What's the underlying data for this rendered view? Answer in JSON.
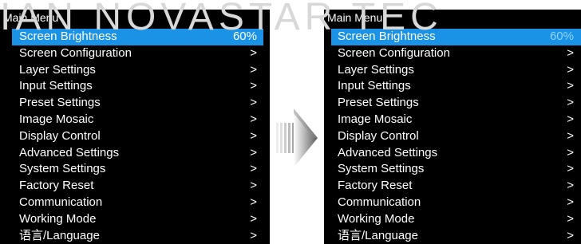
{
  "watermark": "IAN NOVASTAR TEC",
  "left_panel": {
    "title": "Main Menu",
    "items": [
      {
        "label": "Screen Brightness",
        "value": "60%"
      },
      {
        "label": "Screen Configuration",
        "value": ">"
      },
      {
        "label": "Layer Settings",
        "value": ">"
      },
      {
        "label": "Input Settings",
        "value": ">"
      },
      {
        "label": "Preset Settings",
        "value": ">"
      },
      {
        "label": "Image Mosaic",
        "value": ">"
      },
      {
        "label": "Display Control",
        "value": ">"
      },
      {
        "label": "Advanced Settings",
        "value": ">"
      },
      {
        "label": "System Settings",
        "value": ">"
      },
      {
        "label": "Factory Reset",
        "value": ">"
      },
      {
        "label": "Communication",
        "value": ">"
      },
      {
        "label": "Working Mode",
        "value": ">"
      },
      {
        "label": "语言/Language",
        "value": ">"
      }
    ]
  },
  "right_panel": {
    "title": "Main Menu",
    "items": [
      {
        "label": "Screen Brightness",
        "value": "60%"
      },
      {
        "label": "Screen Configuration",
        "value": ">"
      },
      {
        "label": "Layer Settings",
        "value": ">"
      },
      {
        "label": "Input Settings",
        "value": ">"
      },
      {
        "label": "Preset Settings",
        "value": ">"
      },
      {
        "label": "Image Mosaic",
        "value": ">"
      },
      {
        "label": "Display Control",
        "value": ">"
      },
      {
        "label": "Advanced Settings",
        "value": ">"
      },
      {
        "label": "System Settings",
        "value": ">"
      },
      {
        "label": "Factory Reset",
        "value": ">"
      },
      {
        "label": "Communication",
        "value": ">"
      },
      {
        "label": "Working Mode",
        "value": ">"
      },
      {
        "label": "语言/Language",
        "value": ">"
      }
    ]
  },
  "arrow_icon": "right-arrow-icon",
  "colors": {
    "panel_background": "#000000",
    "selected_background": "#1a93e6",
    "selected_value_right": "#8fd2ff",
    "text": "#ffffff",
    "watermark": "#d8d8d8"
  }
}
